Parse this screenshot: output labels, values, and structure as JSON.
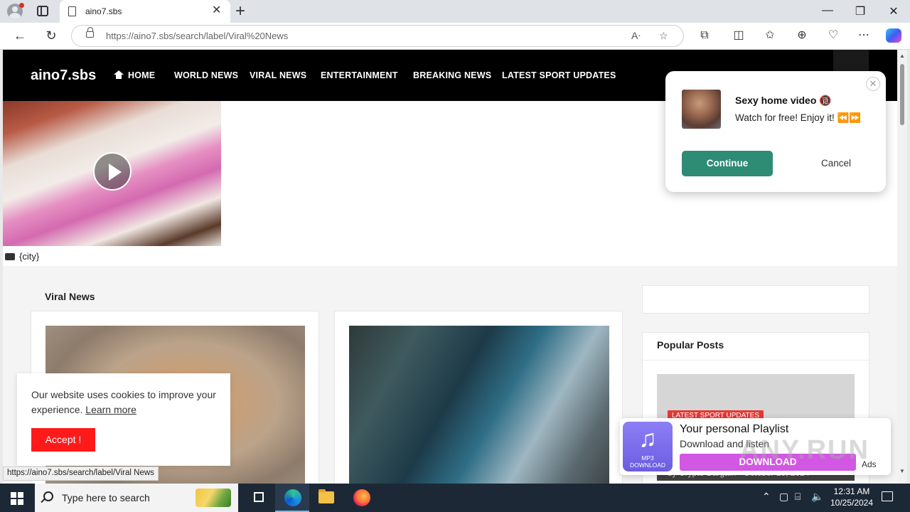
{
  "browser": {
    "tab_title": "aino7.sbs",
    "url": "https://aino7.sbs/search/label/Viral%20News",
    "tab_close_glyph": "✕",
    "new_tab_glyph": "+",
    "window_controls": [
      "—",
      "❐",
      "✕"
    ]
  },
  "site": {
    "logo": "aino7.sbs",
    "menu": [
      "HOME",
      "WORLD NEWS",
      "VIRAL NEWS",
      "ENTERTAINMENT",
      "BREAKING NEWS",
      "LATEST SPORT UPDATES"
    ],
    "city_label": "{city}",
    "section_title": "Viral News",
    "popular_title": "Popular Posts",
    "popular_tag": "LATEST SPORT UPDATES",
    "popular_meta": "by Crypto Bargain - October 10, 2024"
  },
  "push_popup": {
    "title": "Sexy home video",
    "title_badge": "🔞",
    "subtitle": "Watch for free! Enjoy it! ⏪⏩",
    "continue": "Continue",
    "cancel": "Cancel",
    "close_glyph": "✕"
  },
  "cookie": {
    "text": "Our website uses cookies to improve your experience.",
    "link": "Learn more",
    "button": "Accept !"
  },
  "status_url": "https://aino7.sbs/search/label/Viral News",
  "ad": {
    "title": "Your personal Playlist",
    "subtitle": "Download and listen",
    "button": "DOWNLOAD",
    "label": "Ads",
    "icon_line1": "MP3",
    "icon_line2": "DOWNLOAD",
    "icon_glyph": "♫"
  },
  "watermark": "ANY.RUN",
  "taskbar": {
    "search_placeholder": "Type here to search",
    "time": "12:31 AM",
    "date": "10/25/2024"
  },
  "colors": {
    "accent_green": "#2e8b74",
    "cookie_red": "#ff1a1a",
    "ad_purple": "#d257e3",
    "tag_red": "#e53935"
  }
}
